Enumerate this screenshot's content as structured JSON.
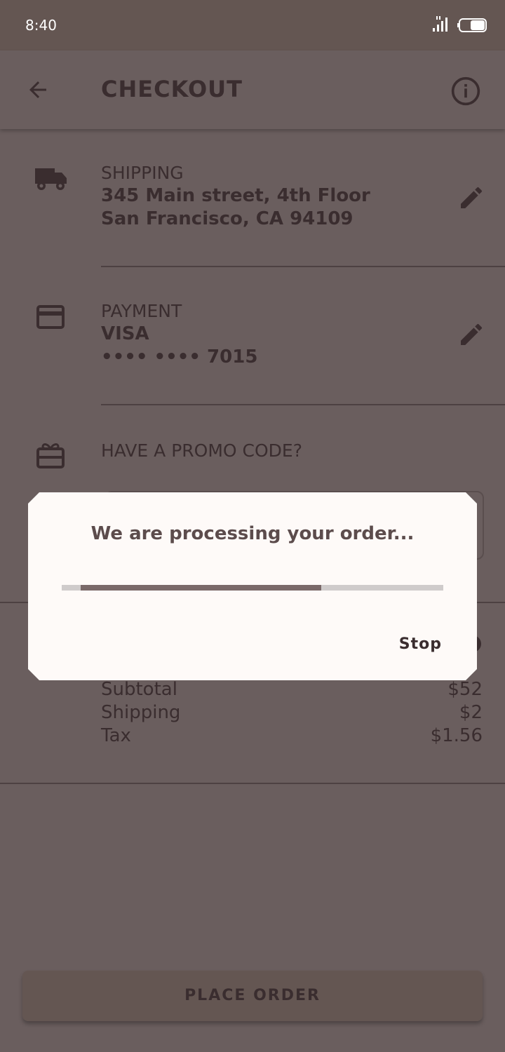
{
  "status_bar": {
    "time": "8:40",
    "signal_icon": "signal-icon",
    "battery_icon": "battery-icon"
  },
  "app_bar": {
    "title": "CHECKOUT",
    "back_icon": "arrow-back-icon",
    "info_icon": "info-icon"
  },
  "shipping": {
    "label": "SHIPPING",
    "line1": "345 Main street, 4th Floor",
    "line2": "San Francisco, CA 94109",
    "icon": "truck-icon"
  },
  "payment": {
    "label": "PAYMENT",
    "line1": "VISA",
    "line2": "•••• •••• 7015",
    "icon": "credit-card-icon"
  },
  "promo": {
    "label": "HAVE A PROMO CODE?",
    "icon": "gift-card-icon"
  },
  "totals": {
    "rows": [
      {
        "label": "Subtotal",
        "value": "$52"
      },
      {
        "label": "Shipping",
        "value": "$2"
      },
      {
        "label": "Tax",
        "value": "$1.56"
      }
    ]
  },
  "place_order": {
    "label": "PLACE ORDER"
  },
  "dialog": {
    "message": "We are processing your order...",
    "stop_label": "Stop",
    "progress_start": 0.05,
    "progress_end": 0.68
  },
  "colors": {
    "scrim_bg": "#6a5e5e",
    "status_bar": "#645652",
    "text_dark": "#3a2d2f",
    "dialog_bg": "#fefaf8",
    "progress_fill": "#7a6969",
    "progress_track": "#cfcbcb"
  }
}
